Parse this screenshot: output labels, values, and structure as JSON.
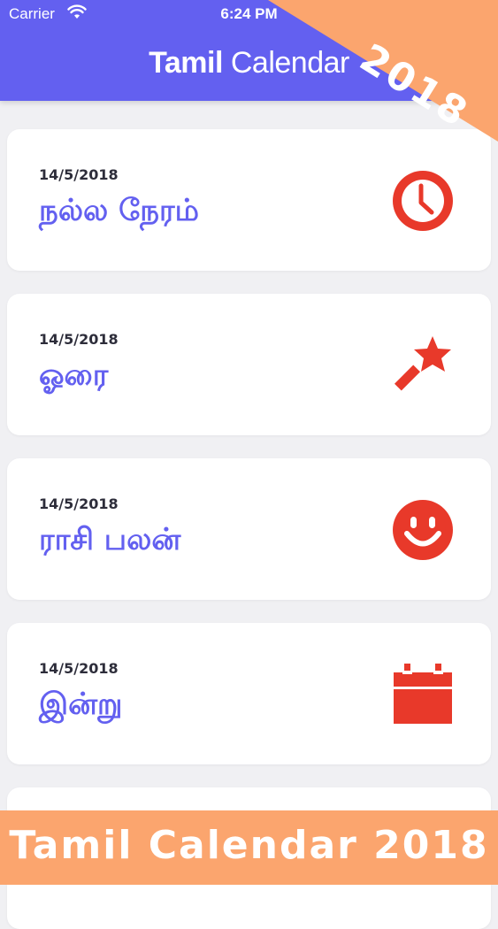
{
  "status_bar": {
    "carrier": "Carrier",
    "time": "6:24 PM"
  },
  "header": {
    "title_bold": "Tamil",
    "title_regular": " Calendar",
    "badge_year": "2018"
  },
  "cards": [
    {
      "date": "14/5/2018",
      "title": "நல்ல நேரம்",
      "icon": "clock-icon"
    },
    {
      "date": "14/5/2018",
      "title": "ஓரை",
      "icon": "magic-wand-icon"
    },
    {
      "date": "14/5/2018",
      "title": "ராசி பலன்",
      "icon": "smiley-icon"
    },
    {
      "date": "14/5/2018",
      "title": "இன்று",
      "icon": "calendar-icon"
    }
  ],
  "banner": {
    "text": "Tamil Calendar 2018"
  },
  "colors": {
    "header": "#6360f0",
    "accent_orange": "#fba56e",
    "icon_red": "#e8392a",
    "title_purple": "#6360f0",
    "background": "#f0f0f3"
  }
}
